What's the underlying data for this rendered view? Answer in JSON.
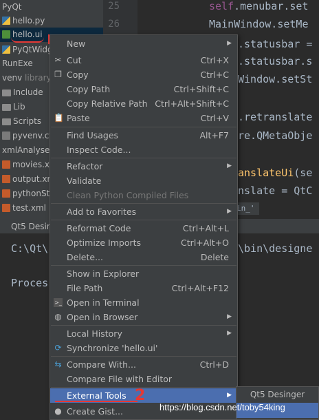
{
  "project_tree": {
    "items": [
      {
        "label": "PyQt",
        "icon": "none"
      },
      {
        "label": "hello.py",
        "icon": "python-file-icon"
      },
      {
        "label": "hello.ui",
        "icon": "ui-file-icon",
        "selected": true
      },
      {
        "label": "PyQtWidg",
        "icon": "python-file-icon"
      },
      {
        "label": "RunExe",
        "icon": "none"
      },
      {
        "label": "venv",
        "tag": "library",
        "icon": "none"
      },
      {
        "label": "Include",
        "icon": "folder-icon"
      },
      {
        "label": "Lib",
        "icon": "folder-icon"
      },
      {
        "label": "Scripts",
        "icon": "folder-icon"
      },
      {
        "label": "pyvenv.cf",
        "icon": "config-file-icon"
      },
      {
        "label": "xmlAnalyse",
        "icon": "none"
      },
      {
        "label": "movies.xm",
        "icon": "xml-file-icon"
      },
      {
        "label": "output.xm",
        "icon": "xml-file-icon"
      },
      {
        "label": "pythonSta",
        "icon": "xml-file-icon"
      },
      {
        "label": "test.xml",
        "icon": "xml-file-icon"
      }
    ]
  },
  "gutter": {
    "line_numbers": [
      "25",
      "26"
    ]
  },
  "editor": {
    "lines": [
      {
        "self": "self",
        "rest": ".menubar.set"
      },
      {
        "self": "",
        "rest": "MainWindow.setMe"
      },
      {
        "self": "",
        "rest": ".statusbar ="
      },
      {
        "self": "",
        "rest": ".statusbar.s"
      },
      {
        "self": "",
        "rest": "Window.setSt"
      },
      {
        "self": "",
        "rest": ".retranslate"
      },
      {
        "self": "",
        "rest": "re.QMetaObje"
      },
      {
        "fn": "anslateUi",
        "rest": "(se"
      },
      {
        "self": "",
        "rest": "nslate = QtC"
      }
    ],
    "hint": "in_'"
  },
  "run_panel": {
    "tab_label": "Qt5 Desinger",
    "log_lines": [
      "C:\\Qt\\",
      "\\bin\\designe",
      "Proces"
    ]
  },
  "context_menu": {
    "items": [
      {
        "label": "New",
        "shortcut": "",
        "submenu": true
      },
      {
        "label": "Cut",
        "shortcut": "Ctrl+X",
        "icon": "scissors-icon"
      },
      {
        "label": "Copy",
        "shortcut": "Ctrl+C",
        "icon": "copy-icon"
      },
      {
        "label": "Copy Path",
        "shortcut": "Ctrl+Shift+C"
      },
      {
        "label": "Copy Relative Path",
        "shortcut": "Ctrl+Alt+Shift+C"
      },
      {
        "label": "Paste",
        "shortcut": "Ctrl+V",
        "icon": "paste-icon"
      },
      {
        "label": "Find Usages",
        "shortcut": "Alt+F7"
      },
      {
        "label": "Inspect Code...",
        "shortcut": ""
      },
      {
        "label": "Refactor",
        "shortcut": "",
        "submenu": true
      },
      {
        "label": "Validate",
        "shortcut": ""
      },
      {
        "label": "Clean Python Compiled Files",
        "shortcut": "",
        "disabled": true
      },
      {
        "label": "Add to Favorites",
        "shortcut": "",
        "submenu": true
      },
      {
        "label": "Reformat Code",
        "shortcut": "Ctrl+Alt+L"
      },
      {
        "label": "Optimize Imports",
        "shortcut": "Ctrl+Alt+O"
      },
      {
        "label": "Delete...",
        "shortcut": "Delete"
      },
      {
        "label": "Show in Explorer",
        "shortcut": ""
      },
      {
        "label": "File Path",
        "shortcut": "Ctrl+Alt+F12"
      },
      {
        "label": "Open in Terminal",
        "shortcut": "",
        "icon": "terminal-icon"
      },
      {
        "label": "Open in Browser",
        "shortcut": "",
        "submenu": true,
        "icon": "globe-icon"
      },
      {
        "label": "Local History",
        "shortcut": "",
        "submenu": true
      },
      {
        "label": "Synchronize 'hello.ui'",
        "shortcut": "",
        "icon": "sync-icon"
      },
      {
        "label": "Compare With...",
        "shortcut": "Ctrl+D",
        "icon": "compare-icon"
      },
      {
        "label": "Compare File with Editor",
        "shortcut": ""
      },
      {
        "label": "External Tools",
        "shortcut": "",
        "submenu": true,
        "active": true
      },
      {
        "label": "Create Gist...",
        "shortcut": "",
        "icon": "github-icon"
      }
    ]
  },
  "submenu": {
    "items": [
      {
        "label": "Qt5 Desinger",
        "active": false
      },
      {
        "label": "",
        "active": true
      }
    ]
  },
  "annotations": {
    "mark_2": "2",
    "watermark": "https://blog.csdn.net/toby54king"
  },
  "colors": {
    "menu_bg": "#3c3f41",
    "highlight": "#4b6eaf",
    "annotation_red": "#e53935",
    "editor_bg": "#2b2b2b"
  }
}
